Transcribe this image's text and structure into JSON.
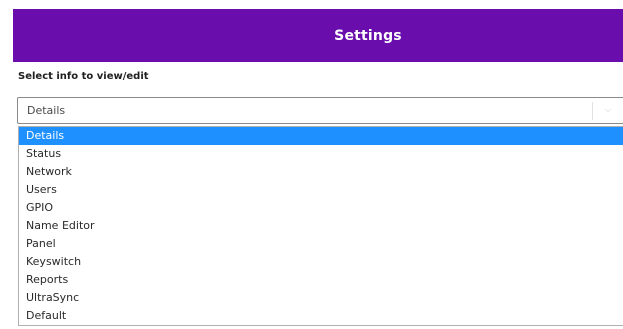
{
  "header": {
    "title": "Settings"
  },
  "form": {
    "label": "Select info to view/edit",
    "select": {
      "value": "Details",
      "options": [
        "Details",
        "Status",
        "Network",
        "Users",
        "GPIO",
        "Name Editor",
        "Panel",
        "Keyswitch",
        "Reports",
        "UltraSync",
        "Default"
      ],
      "highlighted_option": "Details"
    }
  },
  "colors": {
    "header_bg": "#6a0dad",
    "highlight": "#1e90ff"
  },
  "icons": {
    "dropdown_arrow": "chevron-down-icon"
  }
}
